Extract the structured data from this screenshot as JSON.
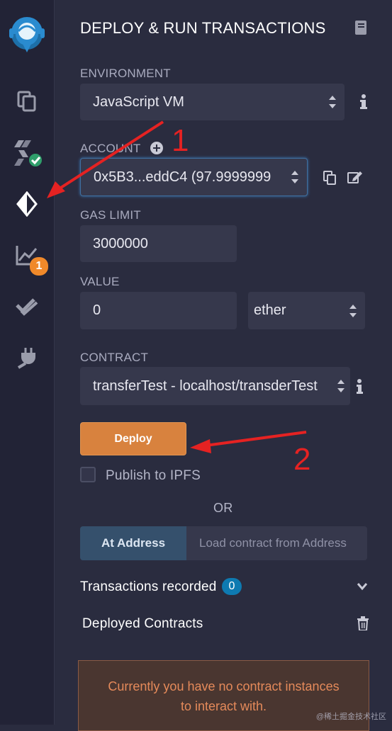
{
  "header": {
    "title": "DEPLOY & RUN TRANSACTIONS"
  },
  "environment": {
    "label": "ENVIRONMENT",
    "value": "JavaScript VM"
  },
  "account": {
    "label": "ACCOUNT",
    "value": "0x5B3...eddC4 (97.9999999"
  },
  "gas_limit": {
    "label": "GAS LIMIT",
    "value": "3000000"
  },
  "value": {
    "label": "VALUE",
    "amount": "0",
    "unit": "ether"
  },
  "contract": {
    "label": "CONTRACT",
    "value": "transferTest - localhost/transderTest"
  },
  "actions": {
    "deploy_label": "Deploy",
    "publish_label": "Publish to IPFS",
    "or_label": "OR",
    "at_address_label": "At Address",
    "at_address_placeholder": "Load contract from Address"
  },
  "transactions": {
    "label": "Transactions recorded",
    "count": "0"
  },
  "deployed": {
    "label": "Deployed Contracts"
  },
  "notice": {
    "line1": "Currently you have no contract instances",
    "line2": "to interact with."
  },
  "sidebar": {
    "analysis_badge": "1"
  },
  "annotations": {
    "marker1": "1",
    "marker2": "2"
  },
  "watermark": "@稀土掘金技术社区",
  "colors": {
    "accent": "#d8823e",
    "badge": "#0e7ab1",
    "annotation": "#e52222"
  }
}
